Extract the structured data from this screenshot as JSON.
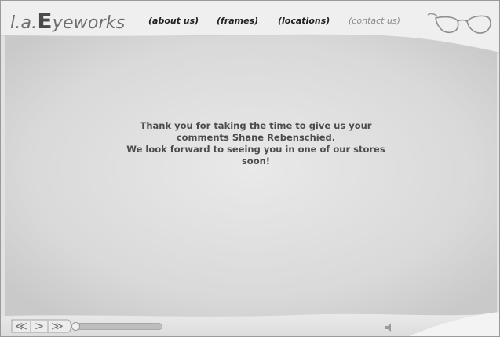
{
  "logo": {
    "prefix": "l.a.",
    "big_letter": "E",
    "suffix": "yeworks"
  },
  "nav": [
    {
      "label": "(about us)",
      "active": false
    },
    {
      "label": "(frames)",
      "active": false
    },
    {
      "label": "(locations)",
      "active": false
    },
    {
      "label": "(contact us)",
      "active": true
    }
  ],
  "message": {
    "lines": [
      "Thank you for taking the time to give us your",
      "comments Shane Rebenschied.",
      "We look forward to seeing you in one of our stores",
      "soon!"
    ]
  },
  "controls": {
    "rewind_label": "≪",
    "play_label": ">",
    "forward_label": "≫",
    "progress": 0.0
  },
  "colors": {
    "background": "#e6e6e6",
    "text": "#4c4c4c",
    "nav": "#222222",
    "nav_active": "#8a8a8a"
  }
}
